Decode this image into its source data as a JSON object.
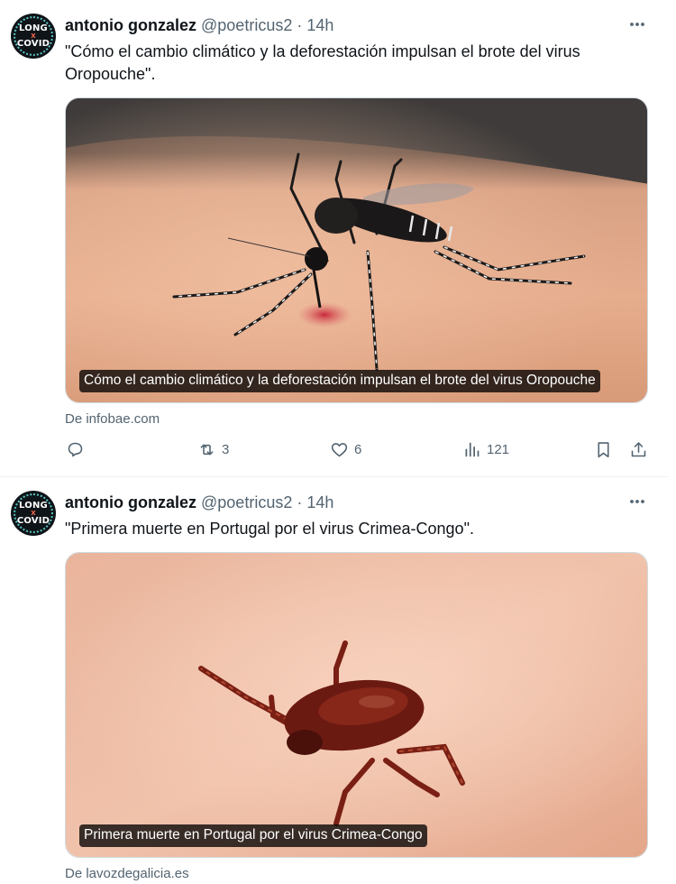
{
  "tweets": [
    {
      "avatar_text": [
        "LONG",
        "X",
        "COVID"
      ],
      "name": "antonio gonzalez",
      "handle": "@poetricus2",
      "separator": "·",
      "time": "14h",
      "text": "\"Cómo el cambio climático y la deforestación impulsan el brote del virus Oropouche\".",
      "card": {
        "caption": "Cómo el cambio climático y la deforestación impulsan el brote del virus Oropouche",
        "source": "De infobae.com",
        "image": "mosquito-on-skin"
      },
      "actions": {
        "reply": "",
        "retweets": "3",
        "likes": "6",
        "views": "121"
      }
    },
    {
      "avatar_text": [
        "LONG",
        "X",
        "COVID"
      ],
      "name": "antonio gonzalez",
      "handle": "@poetricus2",
      "separator": "·",
      "time": "14h",
      "text": "\"Primera muerte en Portugal por el virus Crimea-Congo\".",
      "card": {
        "caption": "Primera muerte en Portugal por el virus Crimea-Congo",
        "source": "De lavozdegalicia.es",
        "image": "tick-on-skin"
      }
    }
  ],
  "icons": {
    "reply": "reply-icon",
    "retweet": "retweet-icon",
    "like": "heart-icon",
    "views": "views-icon",
    "bookmark": "bookmark-icon",
    "share": "share-icon",
    "more": "more-icon"
  },
  "colors": {
    "text": "#0f1419",
    "secondary": "#536471",
    "border": "#cfd9de"
  }
}
